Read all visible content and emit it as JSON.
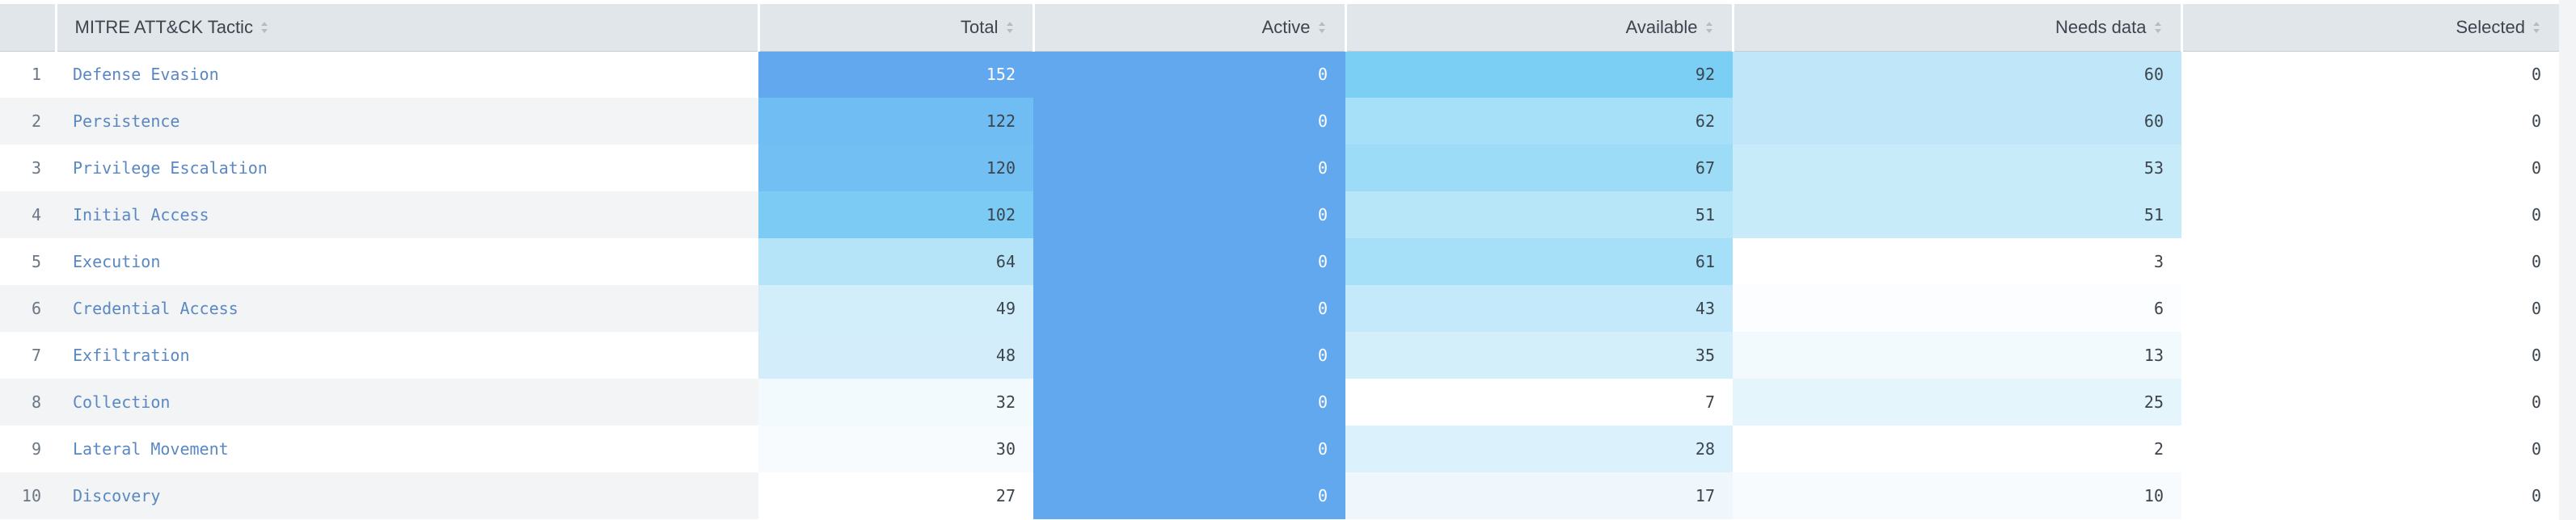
{
  "table": {
    "columns": [
      {
        "key": "index",
        "label": ""
      },
      {
        "key": "tactic",
        "label": "MITRE ATT&CK Tactic",
        "sortable": true
      },
      {
        "key": "total",
        "label": "Total",
        "sortable": true
      },
      {
        "key": "active",
        "label": "Active",
        "sortable": true
      },
      {
        "key": "available",
        "label": "Available",
        "sortable": true
      },
      {
        "key": "needs_data",
        "label": "Needs data",
        "sortable": true
      },
      {
        "key": "selected",
        "label": "Selected",
        "sortable": true
      }
    ],
    "rows": [
      {
        "index": "1",
        "tactic": "Defense Evasion",
        "total": "152",
        "active": "0",
        "available": "92",
        "needs_data": "60",
        "selected": "0"
      },
      {
        "index": "2",
        "tactic": "Persistence",
        "total": "122",
        "active": "0",
        "available": "62",
        "needs_data": "60",
        "selected": "0"
      },
      {
        "index": "3",
        "tactic": "Privilege Escalation",
        "total": "120",
        "active": "0",
        "available": "67",
        "needs_data": "53",
        "selected": "0"
      },
      {
        "index": "4",
        "tactic": "Initial Access",
        "total": "102",
        "active": "0",
        "available": "51",
        "needs_data": "51",
        "selected": "0"
      },
      {
        "index": "5",
        "tactic": "Execution",
        "total": "64",
        "active": "0",
        "available": "61",
        "needs_data": "3",
        "selected": "0"
      },
      {
        "index": "6",
        "tactic": "Credential Access",
        "total": "49",
        "active": "0",
        "available": "43",
        "needs_data": "6",
        "selected": "0"
      },
      {
        "index": "7",
        "tactic": "Exfiltration",
        "total": "48",
        "active": "0",
        "available": "35",
        "needs_data": "13",
        "selected": "0"
      },
      {
        "index": "8",
        "tactic": "Collection",
        "total": "32",
        "active": "0",
        "available": "7",
        "needs_data": "25",
        "selected": "0"
      },
      {
        "index": "9",
        "tactic": "Lateral Movement",
        "total": "30",
        "active": "0",
        "available": "28",
        "needs_data": "2",
        "selected": "0"
      },
      {
        "index": "10",
        "tactic": "Discovery",
        "total": "27",
        "active": "0",
        "available": "17",
        "needs_data": "10",
        "selected": "0"
      }
    ],
    "cell_colors": {
      "total": [
        "#62a8ef",
        "#6fbdf3",
        "#72bff4",
        "#7bcbf4",
        "#b5e4f8",
        "#d2eefa",
        "#d3eefa",
        "#f3fafd",
        "#f7fbfe",
        "#ffffff"
      ],
      "active": [
        "#62a8ef",
        "#62a8ef",
        "#62a8ef",
        "#62a8ef",
        "#62a8ef",
        "#62a8ef",
        "#62a8ef",
        "#62a8ef",
        "#62a8ef",
        "#62a8ef"
      ],
      "available": [
        "#7bcef4",
        "#a5dff8",
        "#9cdcf7",
        "#b8e6f9",
        "#a5dff8",
        "#c4e9fa",
        "#d3effa",
        "#ffffff",
        "#dbf1fc",
        "#eff7fd"
      ],
      "needs_data": [
        "#c0e7f9",
        "#c0e7f9",
        "#c8ebfa",
        "#c8ebfa",
        "#ffffff",
        "#fbfdfe",
        "#f3fafd",
        "#e5f5fc",
        "#ffffff",
        "#f7fbfe"
      ]
    },
    "text_colors": {
      "total": [
        "#ffffff",
        "#3c444d",
        "#3c444d",
        "#3c444d",
        "#3c444d",
        "#3c444d",
        "#3c444d",
        "#3c444d",
        "#3c444d",
        "#3c444d"
      ],
      "active": [
        "#ffffff",
        "#ffffff",
        "#ffffff",
        "#ffffff",
        "#ffffff",
        "#ffffff",
        "#ffffff",
        "#ffffff",
        "#ffffff",
        "#ffffff"
      ],
      "available": [
        "#3c444d",
        "#3c444d",
        "#3c444d",
        "#3c444d",
        "#3c444d",
        "#3c444d",
        "#3c444d",
        "#3c444d",
        "#3c444d",
        "#3c444d"
      ],
      "needs_data": [
        "#3c444d",
        "#3c444d",
        "#3c444d",
        "#3c444d",
        "#3c444d",
        "#3c444d",
        "#3c444d",
        "#3c444d",
        "#3c444d",
        "#3c444d"
      ]
    }
  }
}
